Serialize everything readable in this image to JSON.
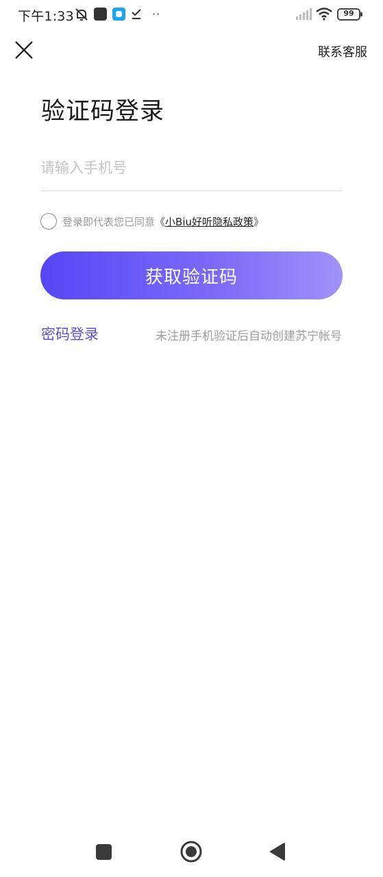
{
  "status_bar": {
    "time": "下午1:33",
    "battery": "99",
    "dots": "··",
    "icons": [
      "bell-off-icon",
      "app-icon-dark",
      "app-icon-blue",
      "download-check-icon",
      "signal-icon",
      "wifi-icon",
      "battery-icon"
    ]
  },
  "header": {
    "close_icon": "close-icon",
    "support_label": "联系客服"
  },
  "main": {
    "title": "验证码登录",
    "phone_placeholder": "请输入手机号",
    "phone_value": "",
    "agreement": {
      "prefix": "登录即代表您已同意",
      "open_bracket": "《",
      "policy_label": "小Biu好听隐私政策",
      "close_bracket": "》",
      "checked": false
    },
    "get_code_label": "获取验证码",
    "password_login_label": "密码登录",
    "register_hint": "未注册手机验证后自动创建苏宁帐号"
  },
  "colors": {
    "accent": "#5e4fd1",
    "button_gradient_start": "#5646f6",
    "button_gradient_end": "#a192f9"
  },
  "nav_bar": {
    "icons": [
      "recents-icon",
      "home-icon",
      "back-icon"
    ]
  }
}
